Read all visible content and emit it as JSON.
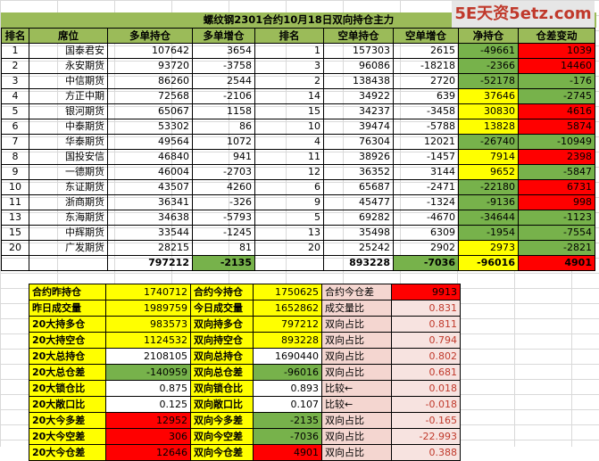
{
  "watermark": "5E天资5etz.com",
  "title": "螺纹钢2301合约10月18日双向持仓主力",
  "headers": [
    "排名",
    "席位",
    "多单持仓",
    "多单增仓",
    "排名",
    "空单持仓",
    "空单增仓",
    "净持仓",
    "仓差变动"
  ],
  "rows": [
    [
      "1",
      "国泰君安",
      "107642",
      "3654",
      "1",
      "157303",
      "2615",
      "-49661",
      "1039"
    ],
    [
      "2",
      "永安期货",
      "93720",
      "-3758",
      "3",
      "96086",
      "-18218",
      "-2366",
      "14460"
    ],
    [
      "3",
      "中信期货",
      "86260",
      "2544",
      "2",
      "138438",
      "2720",
      "-52178",
      "-176"
    ],
    [
      "4",
      "方正中期",
      "72568",
      "-2106",
      "14",
      "34922",
      "639",
      "37646",
      "-2745"
    ],
    [
      "5",
      "银河期货",
      "65067",
      "1158",
      "15",
      "34237",
      "-3458",
      "30830",
      "4616"
    ],
    [
      "6",
      "中泰期货",
      "53302",
      "86",
      "10",
      "39474",
      "-5788",
      "13828",
      "5874"
    ],
    [
      "7",
      "华泰期货",
      "49564",
      "1072",
      "4",
      "76304",
      "12021",
      "-26740",
      "-10949"
    ],
    [
      "8",
      "国投安信",
      "46840",
      "941",
      "11",
      "38926",
      "-1457",
      "7914",
      "2398"
    ],
    [
      "9",
      "一德期货",
      "46004",
      "-2703",
      "12",
      "36352",
      "3144",
      "9652",
      "-5847"
    ],
    [
      "10",
      "东证期货",
      "43507",
      "4260",
      "6",
      "65687",
      "-2471",
      "-22180",
      "6731"
    ],
    [
      "11",
      "浙商期货",
      "36341",
      "-326",
      "9",
      "45477",
      "-1324",
      "-9136",
      "998"
    ],
    [
      "13",
      "东海期货",
      "34638",
      "-5793",
      "5",
      "69282",
      "-4670",
      "-34644",
      "-1123"
    ],
    [
      "15",
      "中辉期货",
      "33544",
      "-1245",
      "13",
      "35498",
      "6309",
      "-1954",
      "-7554"
    ],
    [
      "20",
      "广发期货",
      "28215",
      "81",
      "20",
      "25242",
      "2902",
      "2973",
      "-2821"
    ]
  ],
  "totals": [
    "",
    "",
    "797212",
    "-2135",
    "",
    "893228",
    "-7036",
    "-96016",
    "4901"
  ],
  "summary": [
    [
      "合约昨持仓",
      "1740712",
      "合约今持仓",
      "1750625",
      "合约今仓差",
      "9913"
    ],
    [
      "昨日成交量",
      "1989759",
      "今日成交量",
      "1652862",
      "成交量比",
      "0.831"
    ],
    [
      "20大持多仓",
      "983573",
      "双向持多仓",
      "797212",
      "双向占比",
      "0.811"
    ],
    [
      "20大持空仓",
      "1124532",
      "双向持空仓",
      "893228",
      "双向占比",
      "0.794"
    ],
    [
      "20大总持仓",
      "2108105",
      "双向总持仓",
      "1690440",
      "双向占比",
      "0.802"
    ],
    [
      "20大总仓差",
      "-140959",
      "双向总仓差",
      "-96016",
      "双向占比",
      "0.681"
    ],
    [
      "20大锁仓比",
      "0.875",
      "双向锁仓比",
      "0.893",
      "比较←",
      "0.018"
    ],
    [
      "20大敞口比",
      "0.125",
      "双向敞口比",
      "0.107",
      "比较←",
      "-0.018"
    ],
    [
      "20大今多差",
      "12952",
      "双向今多差",
      "-2135",
      "双向占比",
      "-0.165"
    ],
    [
      "20大今空差",
      "306",
      "双向今空差",
      "-7036",
      "双向占比",
      "-22.993"
    ],
    [
      "20大今仓差",
      "12646",
      "双向今仓差",
      "4901",
      "双向占比",
      "0.388"
    ]
  ]
}
